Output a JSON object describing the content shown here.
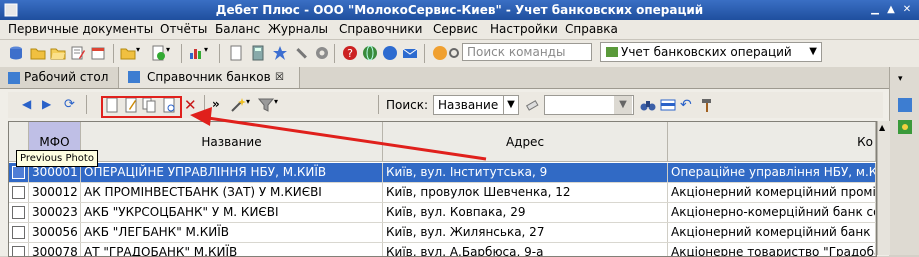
{
  "window": {
    "title": "Дебет Плюс - ООО \"МолокоСервис-Киев\" - Учет банковских операций"
  },
  "menu": [
    "Первичные документы",
    "Отчёты",
    "Баланс",
    "Журналы",
    "Справочники",
    "Сервис",
    "Настройки",
    "Справка"
  ],
  "toolbar": {
    "command_search_placeholder": "Поиск команды",
    "operation_selector": "Учет банковских операций"
  },
  "tabs": [
    {
      "label": "Рабочий стол"
    },
    {
      "label": "Справочник банков"
    }
  ],
  "doc_toolbar": {
    "search_label": "Поиск:",
    "search_field_value": "Название",
    "more_label": "»"
  },
  "tooltip": "Previous Photo",
  "table": {
    "columns": [
      "МФО",
      "Название",
      "Адрес",
      "Ко"
    ],
    "rows": [
      {
        "mfo": "300001",
        "name": "ОПЕРАЦІЙНЕ УПРАВЛІННЯ НБУ, М.КИЇВ",
        "address": "Київ, вул. Інститутська, 9",
        "full": "Операційне управління НБУ, м.Київ"
      },
      {
        "mfo": "300012",
        "name": "АК ПРОМІНВЕСТБАНК (ЗАТ) У М.КИЄВІ",
        "address": "Київ, провулок Шевченка, 12",
        "full": "Акціонерний комерційний   промі"
      },
      {
        "mfo": "300023",
        "name": "АКБ \"УКРСОЦБАНК\" У М. КИЄВІ",
        "address": "Київ, вул. Ковпака, 29",
        "full": "Акціонерно-комерційний банк со"
      },
      {
        "mfo": "300056",
        "name": "АКБ \"ЛЕГБАНК\" М.КИЇВ",
        "address": "Київ, вул. Жилянська, 27",
        "full": "Акціонерний комерційний банк \"Л"
      },
      {
        "mfo": "300078",
        "name": "АТ  \"ГРАДОБАНК\" М.КИЇВ",
        "address": "Київ, вул. А.Барбюса, 9-а",
        "full": "Акціонерне товариство  \"Градоба"
      }
    ]
  },
  "colors": {
    "selection": "#3169c6",
    "annotation": "#e0201c",
    "title_bar": "#2a5db0"
  }
}
